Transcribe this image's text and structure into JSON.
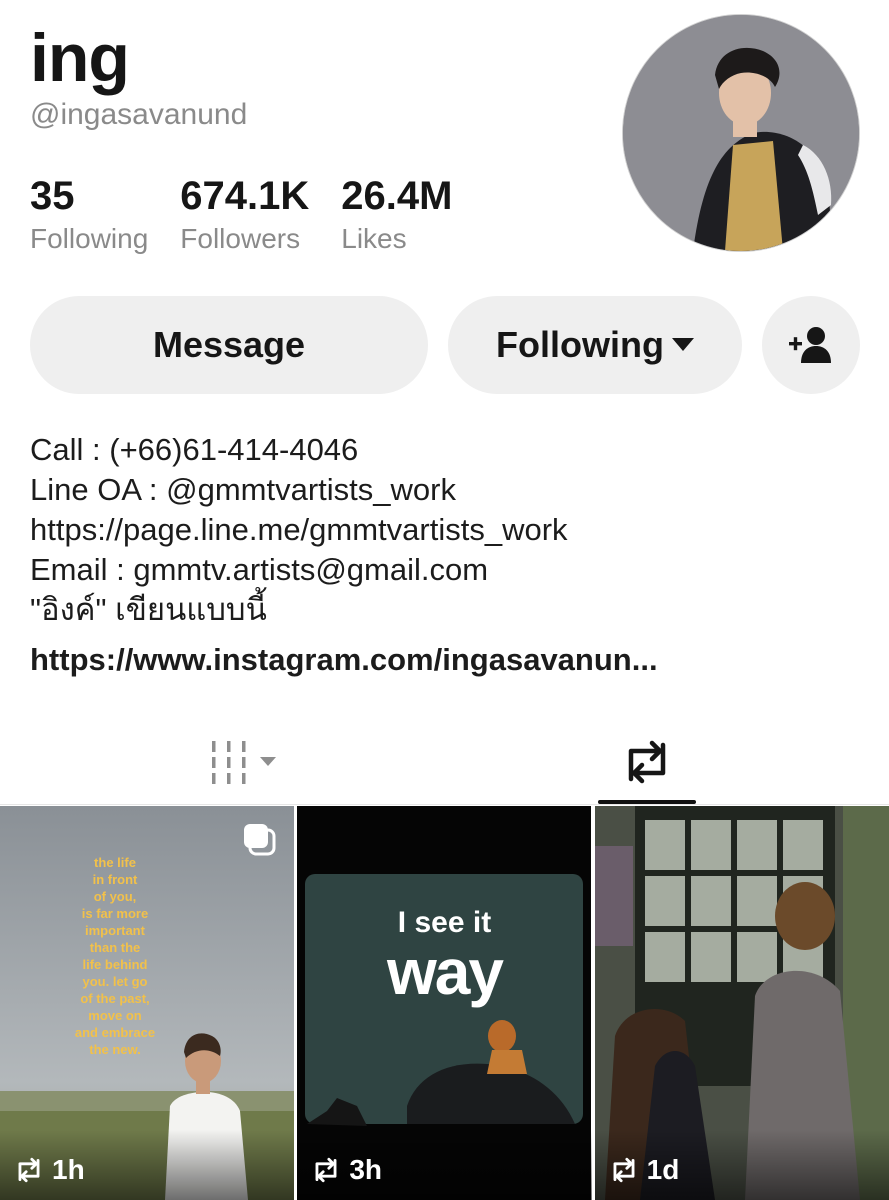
{
  "profile": {
    "display_name": "ing",
    "username": "@ingasavanund",
    "stats": [
      {
        "value": "35",
        "label": "Following"
      },
      {
        "value": "674.1K",
        "label": "Followers"
      },
      {
        "value": "26.4M",
        "label": "Likes"
      }
    ]
  },
  "actions": {
    "message_label": "Message",
    "following_label": "Following"
  },
  "bio": {
    "lines": [
      "Call : (+66)61-414-4046",
      "Line OA : @gmmtvartists_work",
      "https://page.line.me/gmmtvartists_work",
      "Email : gmmtv.artists@gmail.com",
      "\"อิงค์\" เขียนแบบนี้"
    ],
    "link": "https://www.instagram.com/ingasavanun..."
  },
  "tabs": [
    {
      "icon": "videos-grid-icon",
      "active": false
    },
    {
      "icon": "repost-icon",
      "active": true
    }
  ],
  "posts": [
    {
      "time": "1h",
      "quote": [
        "the life",
        "in front",
        "of you,",
        "is far more",
        "important",
        "than the",
        "life behind",
        "you. let go",
        "of the past,",
        "move on",
        "and embrace",
        "the new."
      ]
    },
    {
      "time": "3h",
      "caption_small": "I see it",
      "caption_big": "way"
    },
    {
      "time": "1d"
    }
  ],
  "colors": {
    "accent_quote": "#f2c14a",
    "button_bg": "#efefef",
    "muted_text": "#8a8a8a"
  }
}
